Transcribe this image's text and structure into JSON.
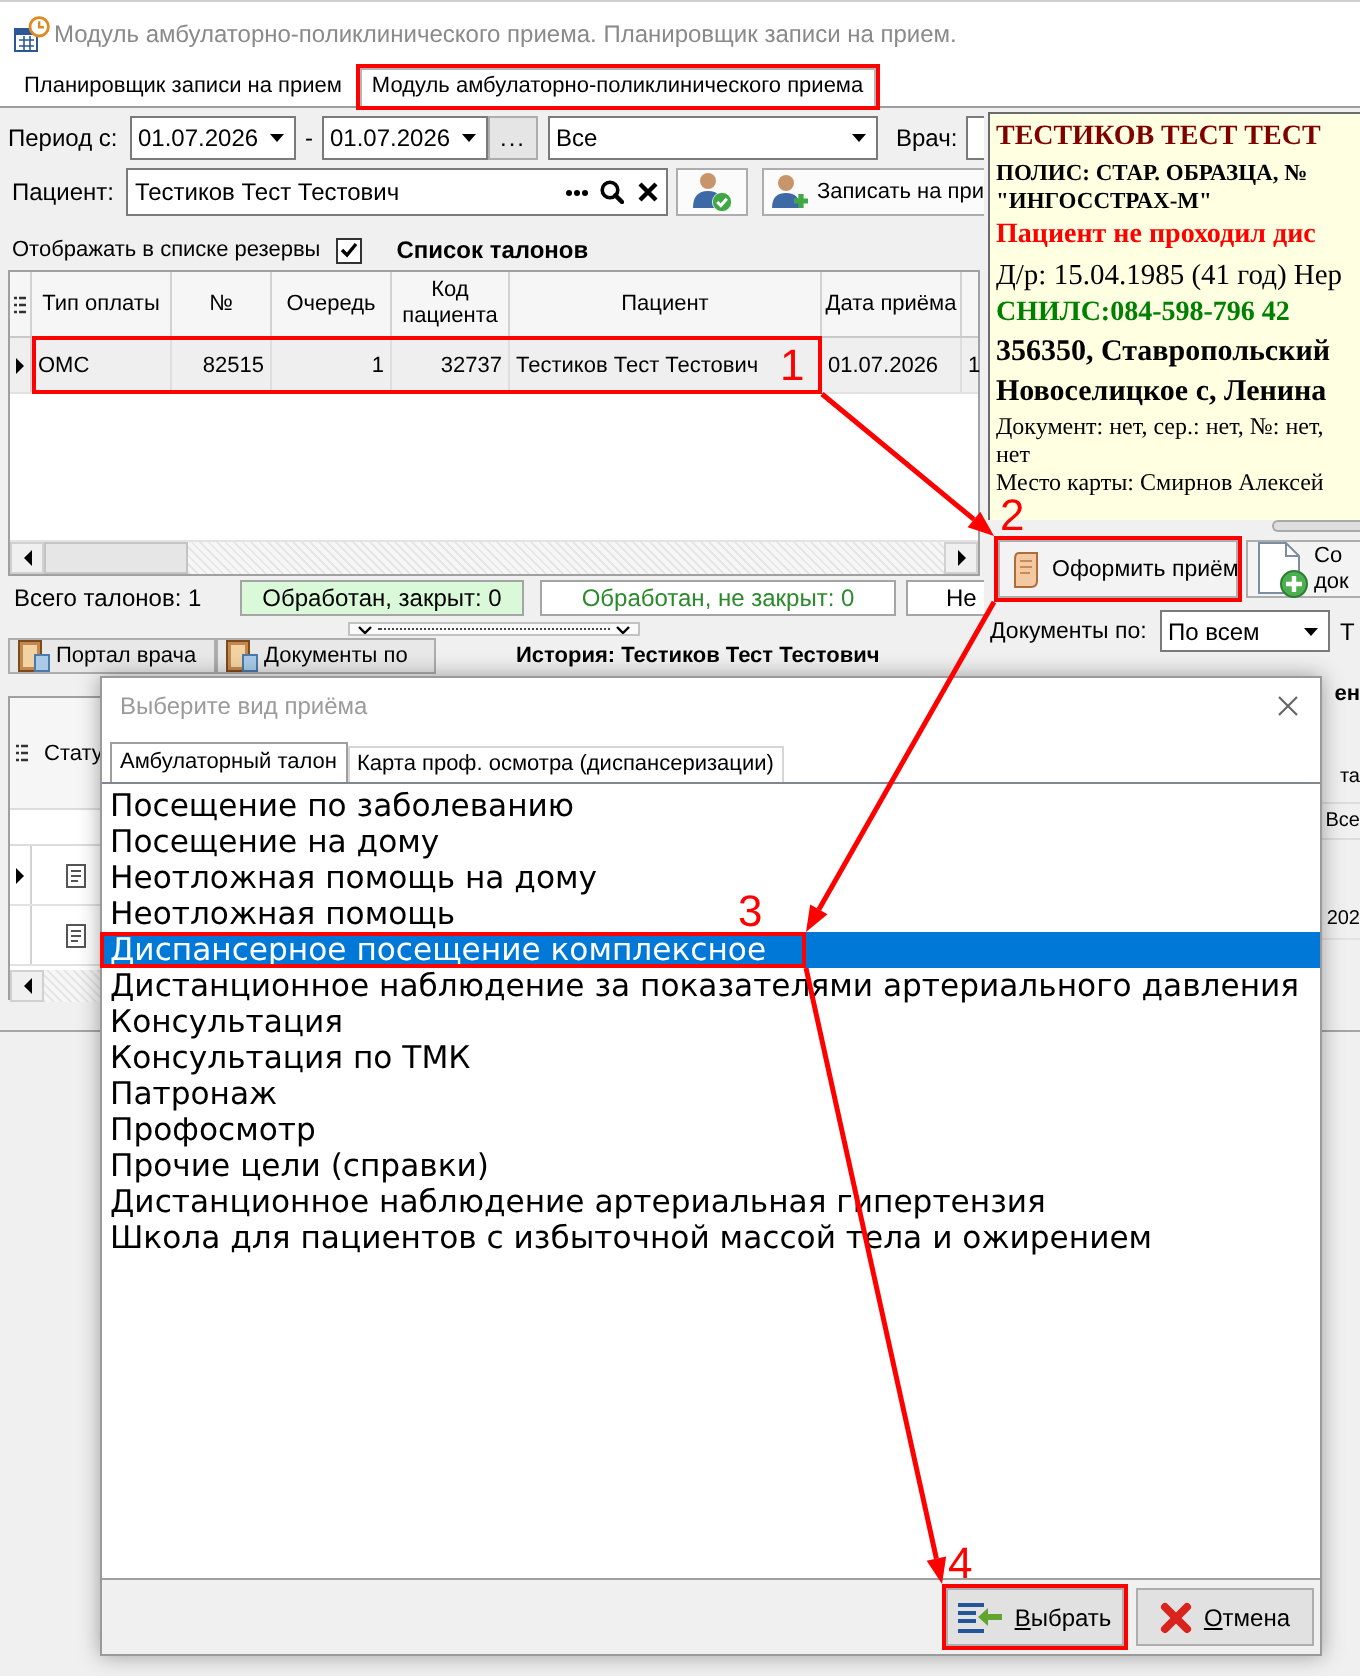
{
  "window": {
    "title": "Модуль амбулаторно-поликлинического приема. Планировщик записи на прием."
  },
  "tabs": [
    {
      "label": "Планировщик записи на прием",
      "selected": false,
      "highlighted": false
    },
    {
      "label": "Модуль амбулаторно-поликлинического приема",
      "selected": true,
      "highlighted": true
    }
  ],
  "filters": {
    "period_label": "Период с:",
    "date_from": "01.07.2026",
    "dash": "-",
    "date_to": "01.07.2026",
    "range_button": "...",
    "scope": "Все",
    "doctor_label": "Врач:",
    "patient_label": "Пациент:",
    "patient": "Тестиков Тест Тестович",
    "book_button": "Записать на при"
  },
  "reserve_toggle": {
    "label": "Отображать в списке резервы",
    "checked": true
  },
  "tickets": {
    "title": "Список талонов",
    "columns": [
      "Тип оплаты",
      "№",
      "Очередь",
      "Код пациента",
      "Пациент",
      "Дата приёма"
    ],
    "rows": [
      {
        "cells": [
          "ОМС",
          "82515",
          "1",
          "32737",
          "Тестиков Тест Тестович",
          "01.07.2026",
          "1"
        ],
        "selected": true,
        "highlighted": true,
        "step": "1"
      }
    ]
  },
  "totals": {
    "label": "Всего талонов: 1",
    "counters": [
      {
        "label": "Обработан, закрыт: 0",
        "kind": "closed"
      },
      {
        "label": "Обработан, не закрыт: 0",
        "kind": "open"
      },
      {
        "label": "Не",
        "kind": "other"
      }
    ]
  },
  "doctor_toolbar": {
    "buttons": [
      "Портал врача",
      "Документы по"
    ],
    "history_title": "История: Тестиков Тест Тестович"
  },
  "history_table": {
    "column_1": "Стату",
    "rows": [
      {
        "selected": true
      },
      {
        "selected": false
      }
    ]
  },
  "patient_card": {
    "lines": [
      {
        "text": "ТЕСТИКОВ ТЕСТ ТЕСТ",
        "kind": "name"
      },
      {
        "text": "ПОЛИС: СТАР. ОБРАЗЦА, №",
        "kind": "policy"
      },
      {
        "text": "\"ИНГОССТРАХ-М\"",
        "kind": "policy"
      },
      {
        "text": "Пациент не проходил дис",
        "kind": "warning"
      },
      {
        "text": "Д/р: 15.04.1985 (41 год) Нер",
        "kind": "dob"
      },
      {
        "text": "СНИЛС:084-598-796 42",
        "kind": "snils"
      },
      {
        "text": "356350, Ставропольский",
        "kind": "address"
      },
      {
        "text": "Новоселицкое с, Ленина",
        "kind": "address"
      },
      {
        "text": "Документ: нет, сер.: нет, №: нет,",
        "kind": "note"
      },
      {
        "text": "нет",
        "kind": "note"
      },
      {
        "text": "Место карты: Смирнов Алексей",
        "kind": "note"
      }
    ]
  },
  "card_actions": [
    {
      "label": "Оформить приём",
      "kind": "visit",
      "highlighted": true,
      "step": "2"
    },
    {
      "label": "Со док",
      "kind": "document",
      "highlighted": false
    }
  ],
  "documents_filter": {
    "label": "Документы по:",
    "value": "По всем",
    "column_3": "Т"
  },
  "documents_list": {
    "title": "ен",
    "column_1": "та",
    "filter": "Все",
    "rows": [
      {
        "cell": "202"
      }
    ]
  },
  "dialog": {
    "title": "Выберите вид приёма",
    "tabs": [
      {
        "label": "Амбулаторный талон",
        "selected": true
      },
      {
        "label": "Карта проф. осмотра (диспансеризации)",
        "selected": false
      }
    ],
    "items": [
      {
        "label": "Посещение по заболеванию",
        "selected": false,
        "highlighted": false
      },
      {
        "label": "Посещение на дому",
        "selected": false,
        "highlighted": false
      },
      {
        "label": "Неотложная помощь на дому",
        "selected": false,
        "highlighted": false
      },
      {
        "label": "Неотложная помощь",
        "selected": false,
        "highlighted": false
      },
      {
        "label": "Диспансерное посещение комплексное",
        "selected": true,
        "highlighted": true,
        "step": "3"
      },
      {
        "label": "Дистанционное наблюдение за показателями артериального давления",
        "selected": false,
        "highlighted": false
      },
      {
        "label": "Консультация",
        "selected": false,
        "highlighted": false
      },
      {
        "label": "Консультация по ТМК",
        "selected": false,
        "highlighted": false
      },
      {
        "label": "Патронаж",
        "selected": false,
        "highlighted": false
      },
      {
        "label": "Профосмотр",
        "selected": false,
        "highlighted": false
      },
      {
        "label": "Прочие цели (справки)",
        "selected": false,
        "highlighted": false
      },
      {
        "label": "Дистанционное наблюдение артериальная гипертензия",
        "selected": false,
        "highlighted": false
      },
      {
        "label": "Школа для пациентов с избыточной массой тела и ожирением",
        "selected": false,
        "highlighted": false
      }
    ],
    "buttons": [
      {
        "label": "Выбрать",
        "kind": "confirm",
        "highlighted": true,
        "step": "4"
      },
      {
        "label": "Отмена",
        "kind": "cancel",
        "highlighted": false
      }
    ]
  }
}
